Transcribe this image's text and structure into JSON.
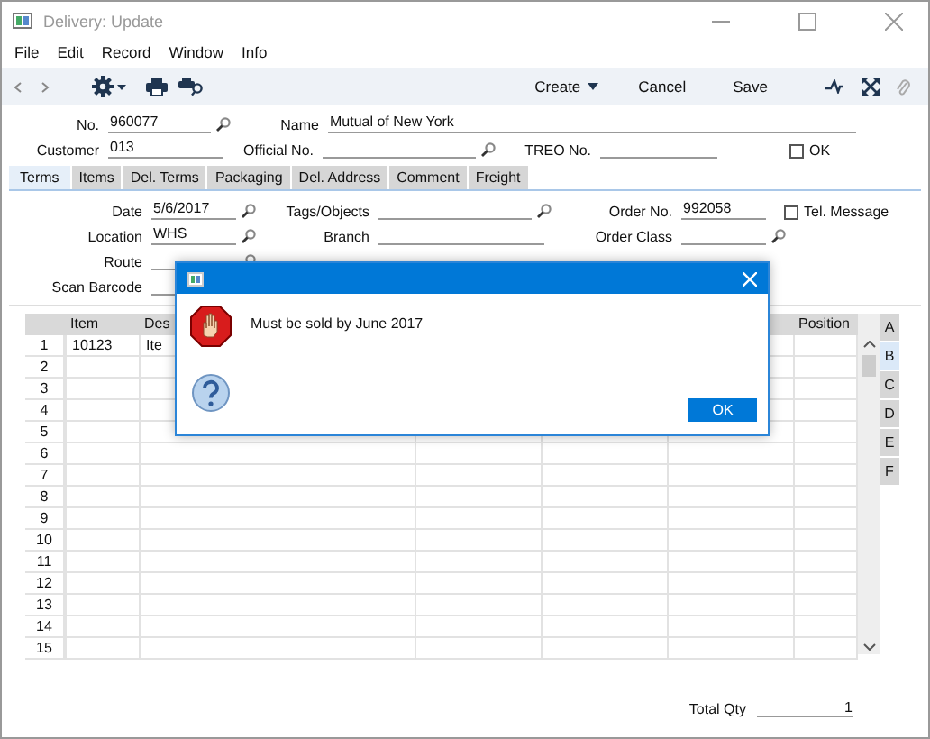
{
  "window": {
    "title": "Delivery: Update"
  },
  "menu": [
    "File",
    "Edit",
    "Record",
    "Window",
    "Info"
  ],
  "toolbar": {
    "create": "Create",
    "cancel": "Cancel",
    "save": "Save"
  },
  "header": [
    [
      {
        "label": "No.",
        "value": "960077",
        "lookup": true
      },
      {
        "label": "Name",
        "value": "Mutual of New York",
        "lookup": false
      }
    ],
    [
      {
        "label": "Customer",
        "value": "013",
        "lookup": false
      },
      {
        "label": "Official No.",
        "lookup": true
      },
      {
        "label": "TREO No.",
        "lookup": false
      },
      {
        "kind": "checkbox",
        "label": "OK",
        "checked": false
      }
    ]
  ],
  "tabs": [
    {
      "label": "Terms",
      "selected": true
    },
    {
      "label": "Items",
      "selected": false
    },
    {
      "label": "Del. Terms",
      "selected": false
    },
    {
      "label": "Packaging",
      "selected": false
    },
    {
      "label": "Del. Address",
      "selected": false
    },
    {
      "label": "Comment",
      "selected": false
    },
    {
      "label": "Freight",
      "selected": false
    }
  ],
  "terms": [
    [
      {
        "label": "Date",
        "value": "5/6/2017",
        "lookup": true
      },
      {
        "label": "Tags/Objects",
        "lookup": true
      },
      {
        "label": "Order No.",
        "value": "992058",
        "lookup": false
      },
      {
        "kind": "checkbox",
        "label": "Tel. Message",
        "checked": false
      }
    ],
    [
      {
        "label": "Location",
        "value": "WHS",
        "lookup": true
      },
      {
        "label": "Branch",
        "lookup": false
      },
      {
        "label": "Order Class",
        "lookup": true
      }
    ],
    [
      {
        "label": "Route",
        "lookup": true
      }
    ],
    [
      {
        "label": "Scan Barcode",
        "lookup": false
      }
    ]
  ],
  "table": {
    "columns": [
      {
        "label": "Item"
      },
      {
        "label": "Des"
      },
      {},
      {},
      {},
      {
        "label": "Position"
      }
    ],
    "rows": [
      {
        "number": "1",
        "cells": [
          "10123",
          "Ite"
        ]
      },
      {
        "number": "2"
      },
      {
        "number": "3"
      },
      {
        "number": "4"
      },
      {
        "number": "5"
      },
      {
        "number": "6"
      },
      {
        "number": "7"
      },
      {
        "number": "8"
      },
      {
        "number": "9"
      },
      {
        "number": "10"
      },
      {
        "number": "11"
      },
      {
        "number": "12"
      },
      {
        "number": "13"
      },
      {
        "number": "14"
      },
      {
        "number": "15"
      }
    ]
  },
  "side_tabs": [
    {
      "label": "A",
      "selected": false
    },
    {
      "label": "B",
      "selected": true
    },
    {
      "label": "C",
      "selected": false
    },
    {
      "label": "D",
      "selected": false
    },
    {
      "label": "E",
      "selected": false
    },
    {
      "label": "F",
      "selected": false
    }
  ],
  "total": {
    "label": "Total Qty",
    "value": "1"
  },
  "dialog": {
    "message": "Must be sold by June 2017",
    "button": "OK"
  }
}
